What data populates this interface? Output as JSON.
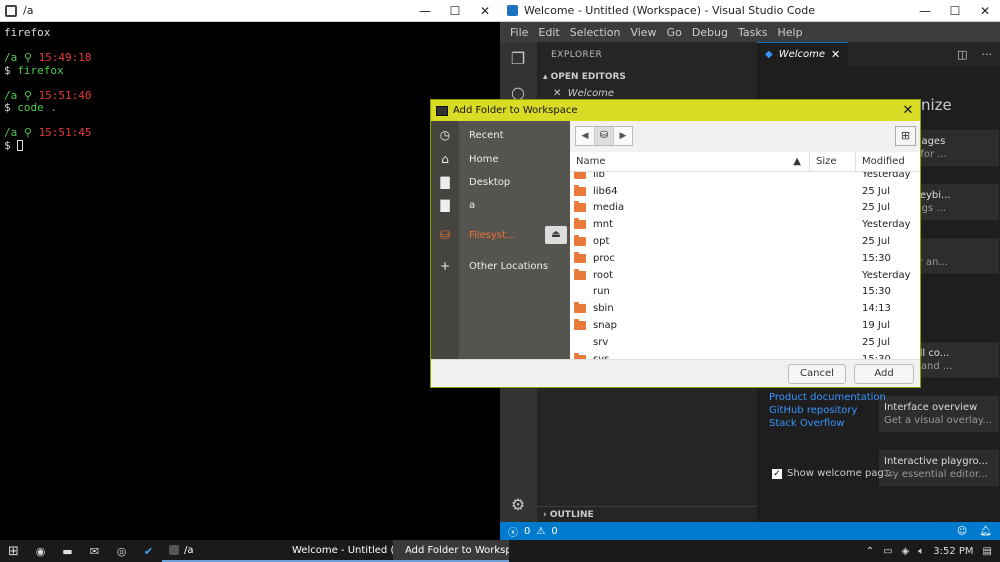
{
  "terminal": {
    "title": "/a",
    "lines": {
      "l1": "firefox",
      "p1_path": "/a",
      "p1_time": "15:49:18",
      "c1_prompt": "$",
      "c1_cmd": "firefox",
      "p2_path": "/a",
      "p2_time": "15:51:40",
      "c2_prompt": "$",
      "c2_cmd": "code .",
      "p3_path": "/a",
      "p3_time": "15:51:45",
      "c3_prompt": "$"
    }
  },
  "vscode": {
    "title": "Welcome - Untitled (Workspace) - Visual Studio Code",
    "menu": [
      "File",
      "Edit",
      "Selection",
      "View",
      "Go",
      "Debug",
      "Tasks",
      "Help"
    ],
    "explorer_header": "EXPLORER",
    "open_editors": "OPEN EDITORS",
    "open_editor_item": "Welcome",
    "outline": "OUTLINE",
    "tab_label": "Welcome",
    "customize_fragment": "nize",
    "cards": [
      {
        "title": "d languages",
        "sub": "upport for ..."
      },
      {
        "title": "s and keybi...",
        "sub": "e settings ..."
      },
      {
        "title": "eme",
        "sub": "e editor an..."
      },
      {
        "title": "d run all co...",
        "sub": "access and ..."
      },
      {
        "title": "Interface overview",
        "sub": "Get a visual overlay..."
      },
      {
        "title": "Interactive playgro...",
        "sub": "Try essential editor..."
      }
    ],
    "links": [
      "Product documentation",
      "GitHub repository",
      "Stack Overflow"
    ],
    "show_welcome": "Show welcome pag...",
    "status_errors": "0",
    "status_warnings": "0"
  },
  "dialog": {
    "title": "Add Folder to Workspace",
    "places": [
      "Recent",
      "Home",
      "Desktop",
      "a",
      "Filesyst...",
      "Other Locations"
    ],
    "columns": {
      "name": "Name",
      "size": "Size",
      "modified": "Modified"
    },
    "files": [
      {
        "name": "lib",
        "modified": "Yesterday",
        "folder": true
      },
      {
        "name": "lib64",
        "modified": "25 Jul",
        "folder": true
      },
      {
        "name": "media",
        "modified": "25 Jul",
        "folder": true
      },
      {
        "name": "mnt",
        "modified": "Yesterday",
        "folder": true
      },
      {
        "name": "opt",
        "modified": "25 Jul",
        "folder": true
      },
      {
        "name": "proc",
        "modified": "15:30",
        "folder": true
      },
      {
        "name": "root",
        "modified": "Yesterday",
        "folder": true
      },
      {
        "name": "run",
        "modified": "15:30",
        "folder": false
      },
      {
        "name": "sbin",
        "modified": "14:13",
        "folder": true
      },
      {
        "name": "snap",
        "modified": "19 Jul",
        "folder": true
      },
      {
        "name": "srv",
        "modified": "25 Jul",
        "folder": false
      },
      {
        "name": "sys",
        "modified": "15:30",
        "folder": true
      }
    ],
    "cancel": "Cancel",
    "add": "Add"
  },
  "taskbar": {
    "apps": [
      "/a",
      "Welcome - Untitled (...",
      "Add Folder to Worksp"
    ],
    "time": "3:52 PM"
  }
}
